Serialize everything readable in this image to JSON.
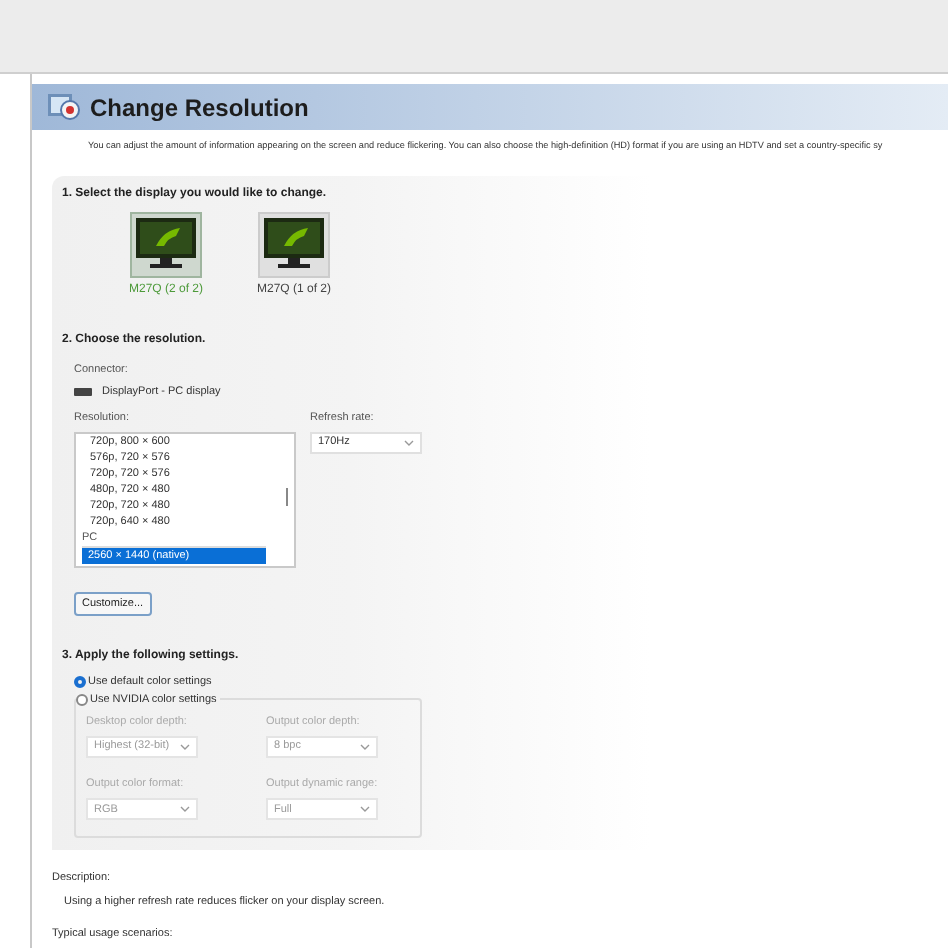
{
  "header": {
    "title": "Change Resolution"
  },
  "intro": "You can adjust the amount of information appearing on the screen and reduce flickering. You can also choose the high-definition (HD) format if you are using an HDTV and set a country-specific sy",
  "step1": {
    "heading": "1. Select the display you would like to change.",
    "displays": [
      {
        "label": "M27Q (2 of 2)",
        "selected": true
      },
      {
        "label": "M27Q (1 of 2)",
        "selected": false
      }
    ]
  },
  "step2": {
    "heading": "2. Choose the resolution.",
    "connector_label": "Connector:",
    "connector": "DisplayPort - PC display",
    "resolution_label": "Resolution:",
    "resolutions": [
      {
        "kind": "item",
        "label": "720p, 800 × 600",
        "selected": false
      },
      {
        "kind": "item",
        "label": "576p, 720 × 576",
        "selected": false
      },
      {
        "kind": "item",
        "label": "720p, 720 × 576",
        "selected": false
      },
      {
        "kind": "item",
        "label": "480p, 720 × 480",
        "selected": false
      },
      {
        "kind": "item",
        "label": "720p, 720 × 480",
        "selected": false
      },
      {
        "kind": "item",
        "label": "720p, 640 × 480",
        "selected": false
      },
      {
        "kind": "group",
        "label": "PC",
        "selected": false
      },
      {
        "kind": "item",
        "label": "2560 × 1440 (native)",
        "selected": true
      }
    ],
    "refresh_label": "Refresh rate:",
    "refresh": "170Hz",
    "customize": "Customize..."
  },
  "step3": {
    "heading": "3. Apply the following settings.",
    "options": [
      {
        "label": "Use default color settings",
        "selected": true
      },
      {
        "label": "Use NVIDIA color settings",
        "selected": false
      }
    ],
    "fields": [
      {
        "label": "Desktop color depth:",
        "value": "Highest (32-bit)",
        "disabled": true
      },
      {
        "label": "Output color depth:",
        "value": "8 bpc",
        "disabled": true
      },
      {
        "label": "Output color format:",
        "value": "RGB",
        "disabled": true
      },
      {
        "label": "Output dynamic range:",
        "value": "Full",
        "disabled": true
      }
    ]
  },
  "description": {
    "label": "Description:",
    "text": "Using a higher refresh rate reduces flicker on your display screen."
  },
  "usage_label": "Typical usage scenarios:"
}
